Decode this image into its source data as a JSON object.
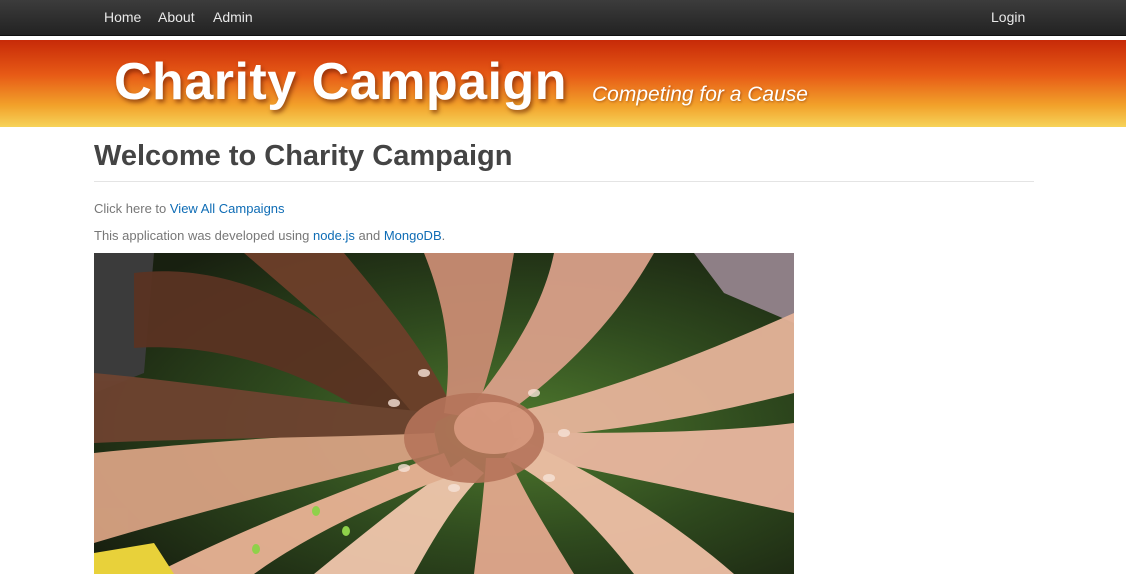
{
  "nav": {
    "home": "Home",
    "about": "About",
    "admin": "Admin",
    "login": "Login"
  },
  "banner": {
    "title": "Charity Campaign",
    "tagline": "Competing for a Cause"
  },
  "main": {
    "heading": "Welcome to Charity Campaign",
    "line1_prefix": "Click here to ",
    "line1_link": "View All Campaigns",
    "line2_prefix": "This application was developed using ",
    "line2_link1": "node.js",
    "line2_mid": " and ",
    "line2_link2": "MongoDB",
    "line2_suffix": "."
  },
  "colors": {
    "navbar": "#2b2b2b",
    "banner_top": "#c72a08",
    "banner_bottom": "#f6d35a",
    "link": "#0e6cb5"
  },
  "hero_image": {
    "icon": "hands-together-photo"
  }
}
